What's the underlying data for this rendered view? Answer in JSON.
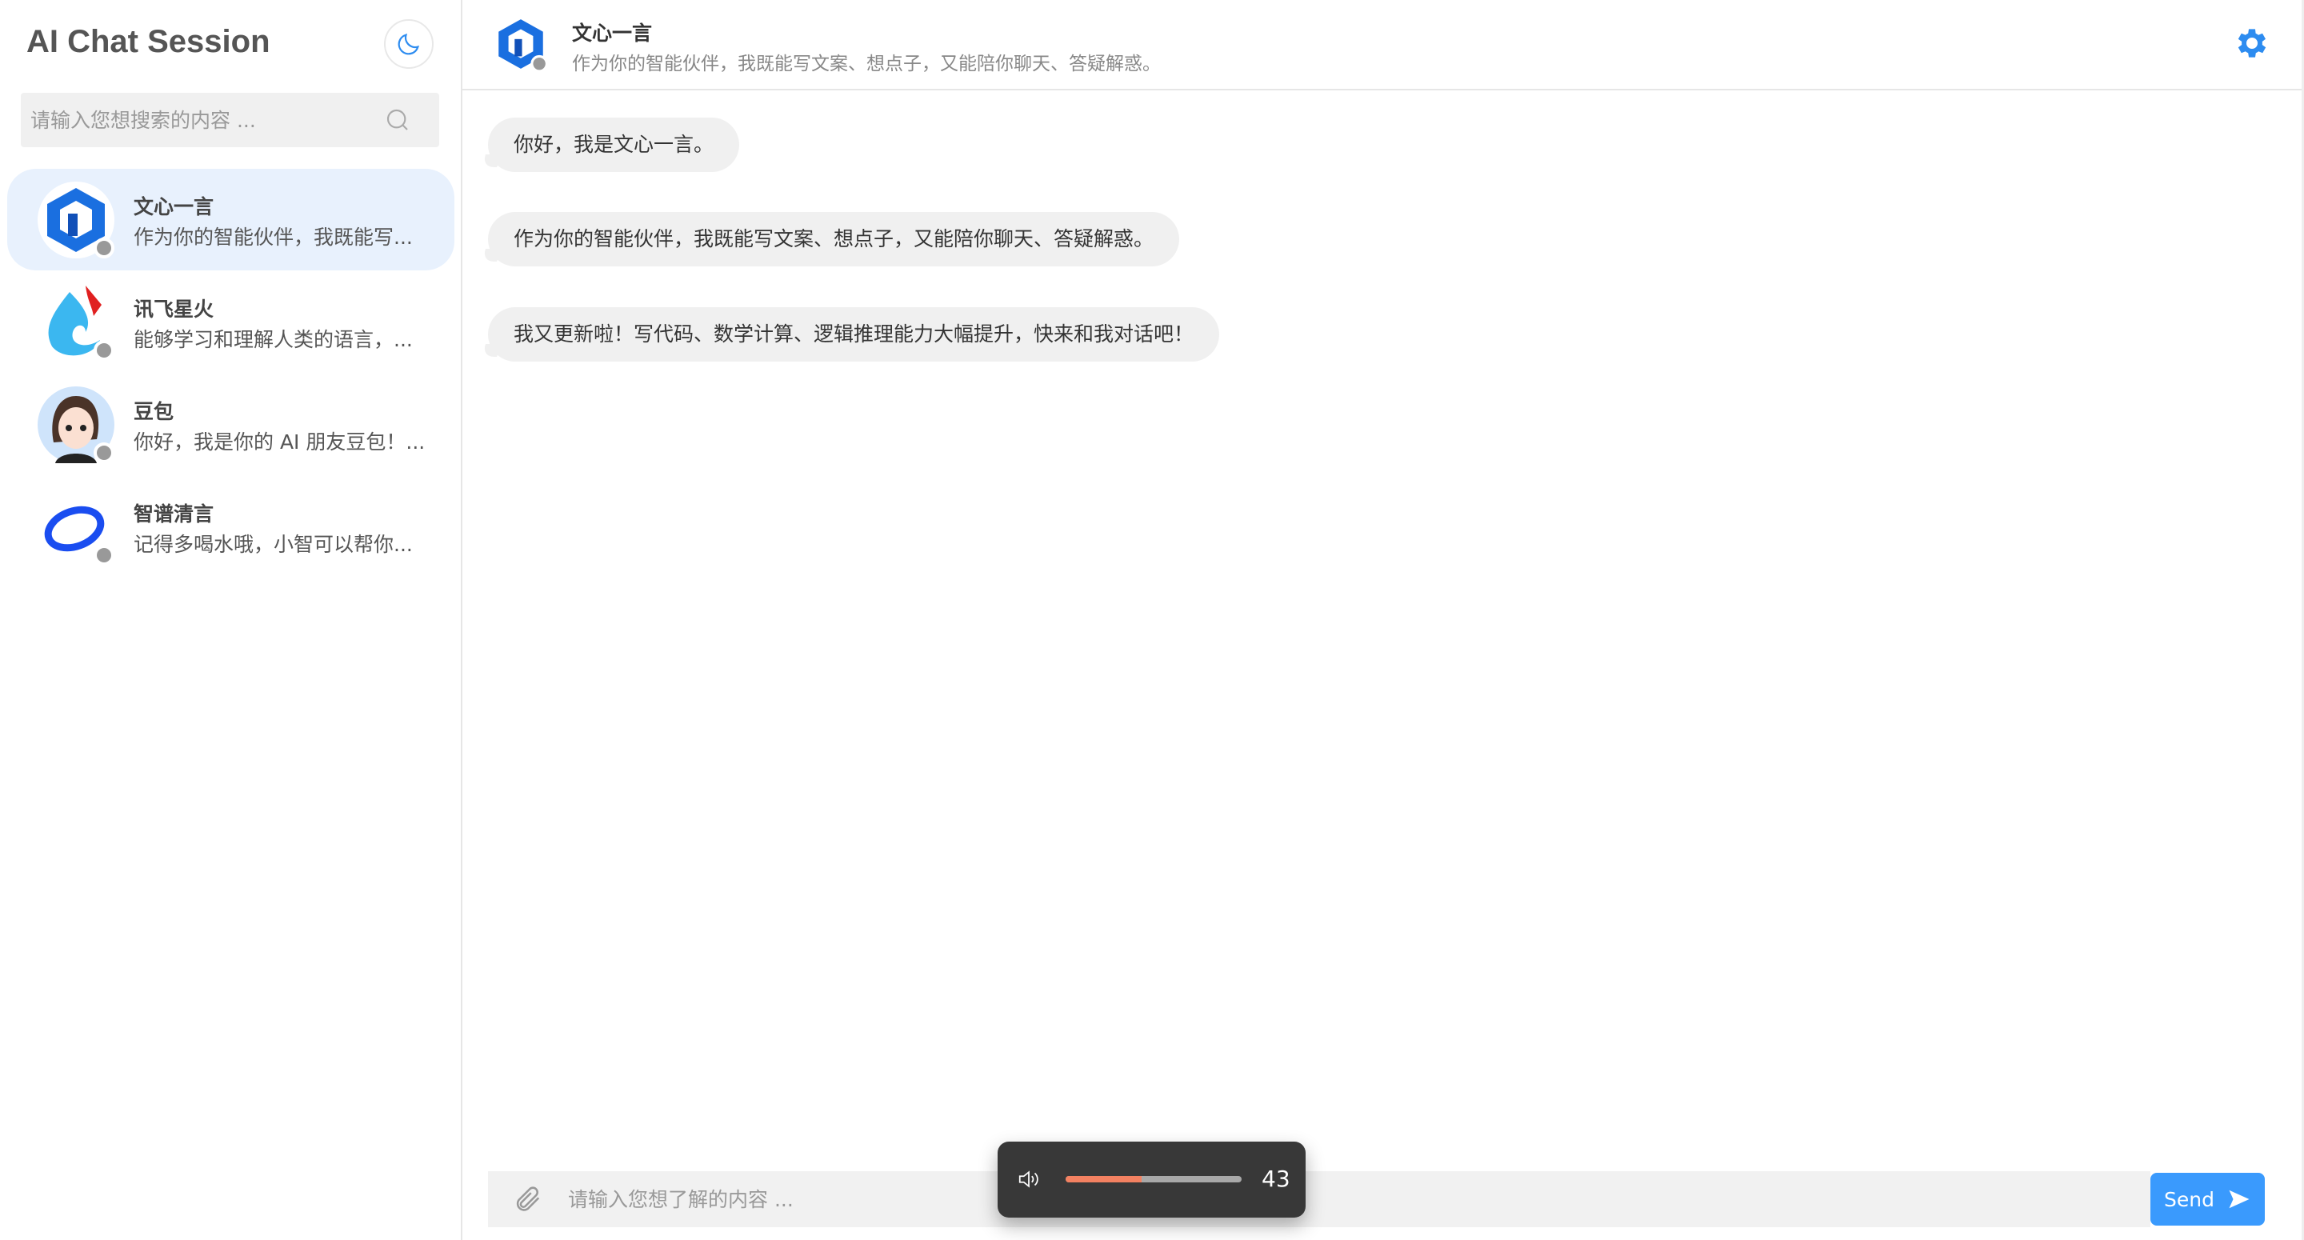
{
  "sidebar": {
    "title": "AI Chat Session",
    "theme_icon": "moon-icon",
    "search_placeholder": "请输入您想搜索的内容 ...",
    "items": [
      {
        "name": "文心一言",
        "preview": "作为你的智能伙伴，我既能写...",
        "active": true,
        "status": "offline"
      },
      {
        "name": "讯飞星火",
        "preview": "能够学习和理解人类的语言，...",
        "active": false,
        "status": "offline"
      },
      {
        "name": "豆包",
        "preview": "你好，我是你的 AI 朋友豆包！...",
        "active": false,
        "status": "offline"
      },
      {
        "name": "智谱清言",
        "preview": "记得多喝水哦，小智可以帮你...",
        "active": false,
        "status": "offline"
      }
    ]
  },
  "header": {
    "name": "文心一言",
    "subtitle": "作为你的智能伙伴，我既能写文案、想点子，又能陪你聊天、答疑解惑。",
    "settings_icon": "gear-icon"
  },
  "messages": [
    {
      "text": "你好，我是文心一言。"
    },
    {
      "text": "作为你的智能伙伴，我既能写文案、想点子，又能陪你聊天、答疑解惑。"
    },
    {
      "text": "我又更新啦！写代码、数学计算、逻辑推理能力大幅提升，快来和我对话吧！"
    }
  ],
  "composer": {
    "placeholder": "请输入您想了解的内容 ...",
    "send_label": "Send"
  },
  "volume": {
    "value": 43,
    "label": "43",
    "fill_color": "#f38161"
  },
  "colors": {
    "accent": "#3a9afd",
    "active_item": "#e8f1fd"
  }
}
